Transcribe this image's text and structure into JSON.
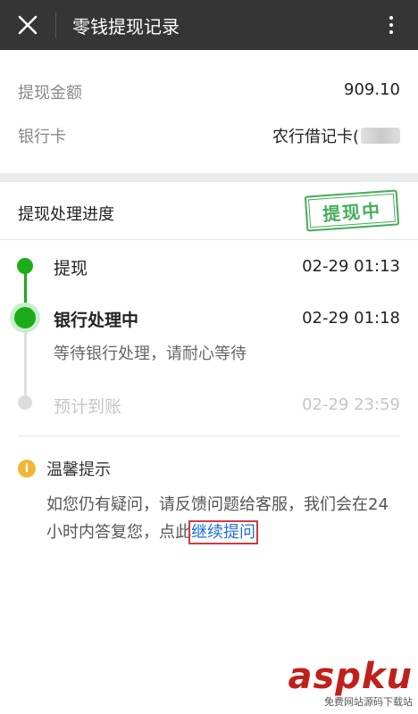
{
  "header": {
    "title": "零钱提现记录"
  },
  "summary": {
    "amount_label": "提现金额",
    "amount_value": "909.10",
    "bank_label": "银行卡",
    "bank_value": "农行借记卡("
  },
  "progress": {
    "title": "提现处理进度",
    "stamp": "提现中",
    "steps": [
      {
        "label": "提现",
        "time": "02-29 01:13"
      },
      {
        "label": "银行处理中",
        "time": "02-29 01:18",
        "note": "等待银行处理，请耐心等待"
      },
      {
        "label": "预计到账",
        "time": "02-29 23:59"
      }
    ]
  },
  "tips": {
    "title": "温馨提示",
    "body": "如您仍有疑问，请反馈问题给客服，我们会在24小时内答复您，点此",
    "link": "继续提问"
  },
  "watermark": {
    "main": "aspku",
    "sub": "免费网站源码下载站"
  },
  "colors": {
    "topbar": "#353535",
    "accent_green": "#1aad19",
    "link_blue": "#1d6fd8",
    "warning_yellow": "#f1b636"
  }
}
